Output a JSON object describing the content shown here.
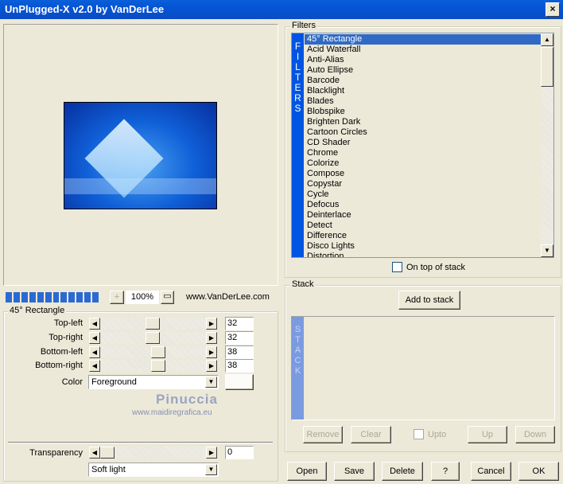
{
  "window": {
    "title": "UnPlugged-X v2.0 by VanDerLee",
    "close": "×"
  },
  "preview": {
    "zoom": "100%",
    "zoom_in": "+",
    "website": "www.VanDerLee.com",
    "progress_segments": 12
  },
  "settings": {
    "group_label": "45° Rectangle",
    "sliders": [
      {
        "label": "Top-left",
        "value": "32",
        "pct": 32
      },
      {
        "label": "Top-right",
        "value": "32",
        "pct": 32
      },
      {
        "label": "Bottom-left",
        "value": "38",
        "pct": 38
      },
      {
        "label": "Bottom-right",
        "value": "38",
        "pct": 38
      }
    ],
    "color_label": "Color",
    "color_value": "Foreground",
    "watermark": {
      "name": "Pinuccia",
      "url": "www.maidiregrafica.eu"
    },
    "transparency": {
      "label": "Transparency",
      "value": "0",
      "pct": 0
    },
    "blend_mode": "Soft light"
  },
  "filters": {
    "group_label": "Filters",
    "side_label": "FILTERS",
    "items": [
      "45° Rectangle",
      "Acid Waterfall",
      "Anti-Alias",
      "Auto Ellipse",
      "Barcode",
      "Blacklight",
      "Blades",
      "Blobspike",
      "Brighten Dark",
      "Cartoon Circles",
      "CD Shader",
      "Chrome",
      "Colorize",
      "Compose",
      "Copystar",
      "Cycle",
      "Defocus",
      "Deinterlace",
      "Detect",
      "Difference",
      "Disco Lights",
      "Distortion"
    ],
    "selected": "45° Rectangle",
    "on_top_label": "On top of stack"
  },
  "stack": {
    "group_label": "Stack",
    "side_label": "STACK",
    "add_label": "Add to stack",
    "remove": "Remove",
    "clear": "Clear",
    "upto": "Upto",
    "up": "Up",
    "down": "Down"
  },
  "buttons": {
    "open": "Open",
    "save": "Save",
    "delete": "Delete",
    "help": "?",
    "cancel": "Cancel",
    "ok": "OK"
  },
  "colors": {
    "accent": "#0054e3",
    "selection": "#316ac5",
    "stack_bar": "#7b9be0"
  }
}
